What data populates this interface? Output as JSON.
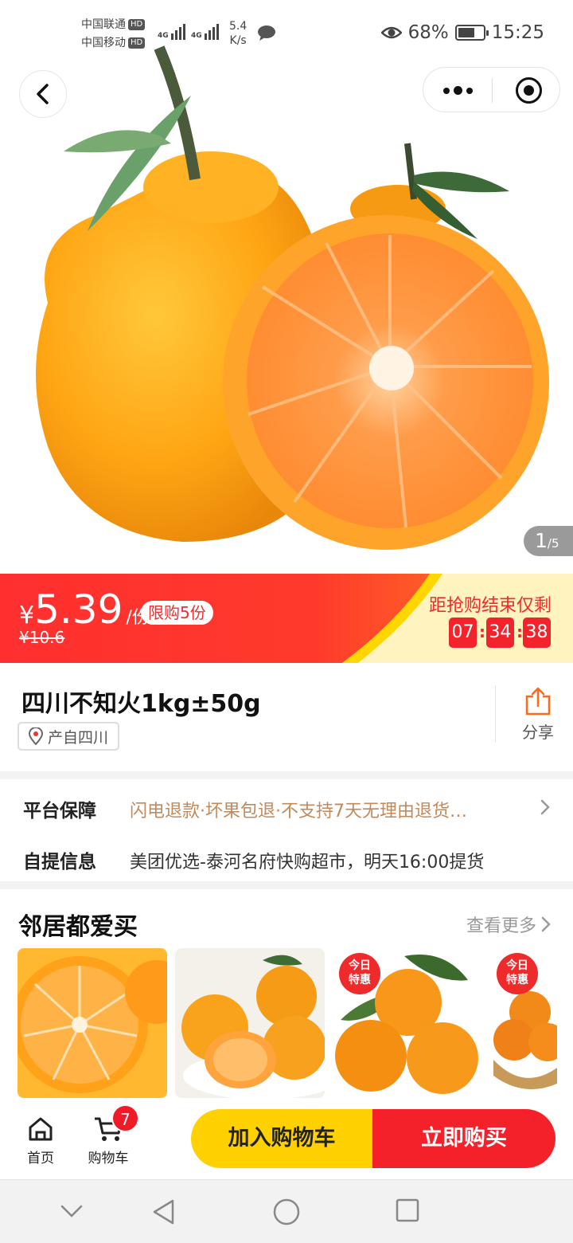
{
  "status_bar": {
    "carrier1": "中国联通",
    "carrier2": "中国移动",
    "hd": "HD",
    "net1": "4G",
    "net2": "4G",
    "speed_value": "5.4",
    "speed_unit": "K/s",
    "battery": "68%",
    "battery_level": 0.68,
    "time": "15:25"
  },
  "gallery": {
    "current": "1",
    "total": "/5"
  },
  "price": {
    "currency": "¥",
    "value": "5.39",
    "unit": "/份",
    "limit": "限购5份",
    "original": "¥10.6"
  },
  "countdown": {
    "label": "距抢购结束仅剩",
    "hours": "07",
    "minutes": "34",
    "seconds": "38",
    "sep": ":"
  },
  "product": {
    "title": "四川不知火1kg±50g",
    "origin": "产自四川",
    "share_label": "分享"
  },
  "info": {
    "guarantee_key": "平台保障",
    "guarantee_value": "闪电退款·坏果包退·不支持7天无理由退货…",
    "pickup_key": "自提信息",
    "pickup_value": "美团优选-泰河名府快购超市，明天16:00提货"
  },
  "recommend": {
    "title": "邻居都爱买",
    "more": "查看更多",
    "tag_today": "今日",
    "tag_deal": "特惠"
  },
  "bottom": {
    "home": "首页",
    "cart": "购物车",
    "cart_count": "7",
    "add_to_cart": "加入购物车",
    "buy_now": "立即购买"
  },
  "colors": {
    "accent_red": "#f4202a",
    "accent_yellow": "#ffd100",
    "guarantee_text": "#c2895a"
  }
}
